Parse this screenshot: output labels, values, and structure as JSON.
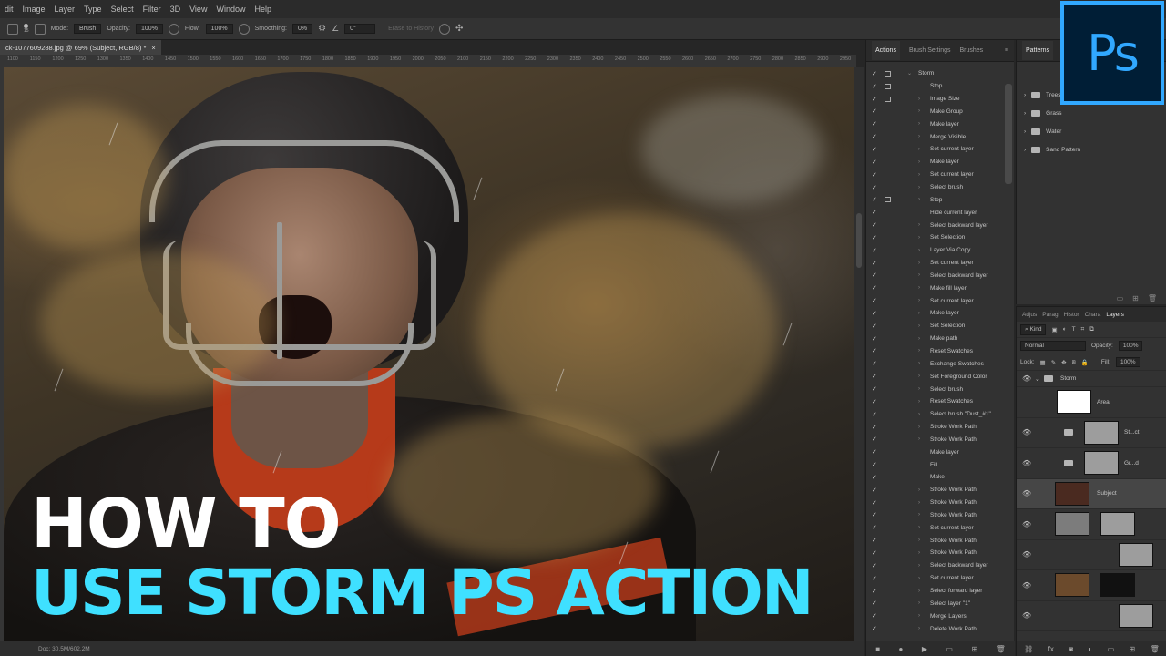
{
  "menu": [
    "dit",
    "Image",
    "Layer",
    "Type",
    "Select",
    "Filter",
    "3D",
    "View",
    "Window",
    "Help"
  ],
  "options": {
    "brush_size": "15",
    "mode_label": "Mode:",
    "mode_value": "Brush",
    "opacity_label": "Opacity:",
    "opacity_value": "100%",
    "flow_label": "Flow:",
    "flow_value": "100%",
    "smoothing_label": "Smoothing:",
    "smoothing_value": "0%",
    "angle_value": "0°",
    "erase_history": "Erase to History"
  },
  "document": {
    "tab_title": "ck-1077609288.jpg @ 69% (Subject, RGB/8) *",
    "close": "×",
    "status": "Doc: 30.5M/602.2M"
  },
  "ruler_ticks": [
    "1100",
    "1150",
    "1200",
    "1250",
    "1300",
    "1350",
    "1400",
    "1450",
    "1500",
    "1550",
    "1600",
    "1650",
    "1700",
    "1750",
    "1800",
    "1850",
    "1900",
    "1950",
    "2000",
    "2050",
    "2100",
    "2150",
    "2200",
    "2250",
    "2300",
    "2350",
    "2400",
    "2450",
    "2500",
    "2550",
    "2600",
    "2650",
    "2700",
    "2750",
    "2800",
    "2850",
    "2900",
    "2950",
    "3000"
  ],
  "overlay": {
    "line1": "HOW TO",
    "line2": "USE STORM PS ACTION",
    "line1_color": "#ffffff",
    "line2_color": "#3fe0ff"
  },
  "actions_panel": {
    "tabs": [
      "Actions",
      "Brush Settings",
      "Brushes"
    ],
    "set_name": "Storm",
    "items": [
      "Stop",
      "Image Size",
      "Make Group",
      "Make layer",
      "Merge Visible",
      "Set current layer",
      "Make layer",
      "Set current layer",
      "Select brush",
      "Stop",
      "Hide current layer",
      "Select backward layer",
      "Set Selection",
      "Layer Via Copy",
      "Set current layer",
      "Select backward layer",
      "Make fill layer",
      "Set current layer",
      "Make layer",
      "Set Selection",
      "Make path",
      "Reset Swatches",
      "Exchange Swatches",
      "Set Foreground Color",
      "Select brush",
      "Reset Swatches",
      "Select brush \"Dust_#1\"",
      "Stroke Work Path",
      "Stroke Work Path",
      "Make layer",
      "Fill",
      "Make",
      "Stroke Work Path",
      "Stroke Work Path",
      "Stroke Work Path",
      "Set current layer",
      "Stroke Work Path",
      "Stroke Work Path",
      "Select backward layer",
      "Set current layer",
      "Select forward layer",
      "Select layer \"1\"",
      "Merge Layers",
      "Delete Work Path"
    ]
  },
  "patterns_panel": {
    "tab": "Patterns",
    "items": [
      "Trees",
      "Grass",
      "Water",
      "Sand Pattern"
    ]
  },
  "layers_panel": {
    "tabs": [
      "Adjus",
      "Parag",
      "Histor",
      "Chara",
      "Layers"
    ],
    "kind": "Kind",
    "blend_mode": "Normal",
    "opacity_label": "Opacity:",
    "opacity_value": "100%",
    "lock_label": "Lock:",
    "fill_label": "Fill:",
    "fill_value": "100%",
    "group_name": "Storm",
    "layers": [
      "Area",
      "St...ct",
      "Gr...d",
      "Subject",
      "",
      "",
      "",
      ""
    ]
  },
  "logo": {
    "text": "Ps",
    "bg": "#001e36",
    "fg": "#31a8ff"
  }
}
